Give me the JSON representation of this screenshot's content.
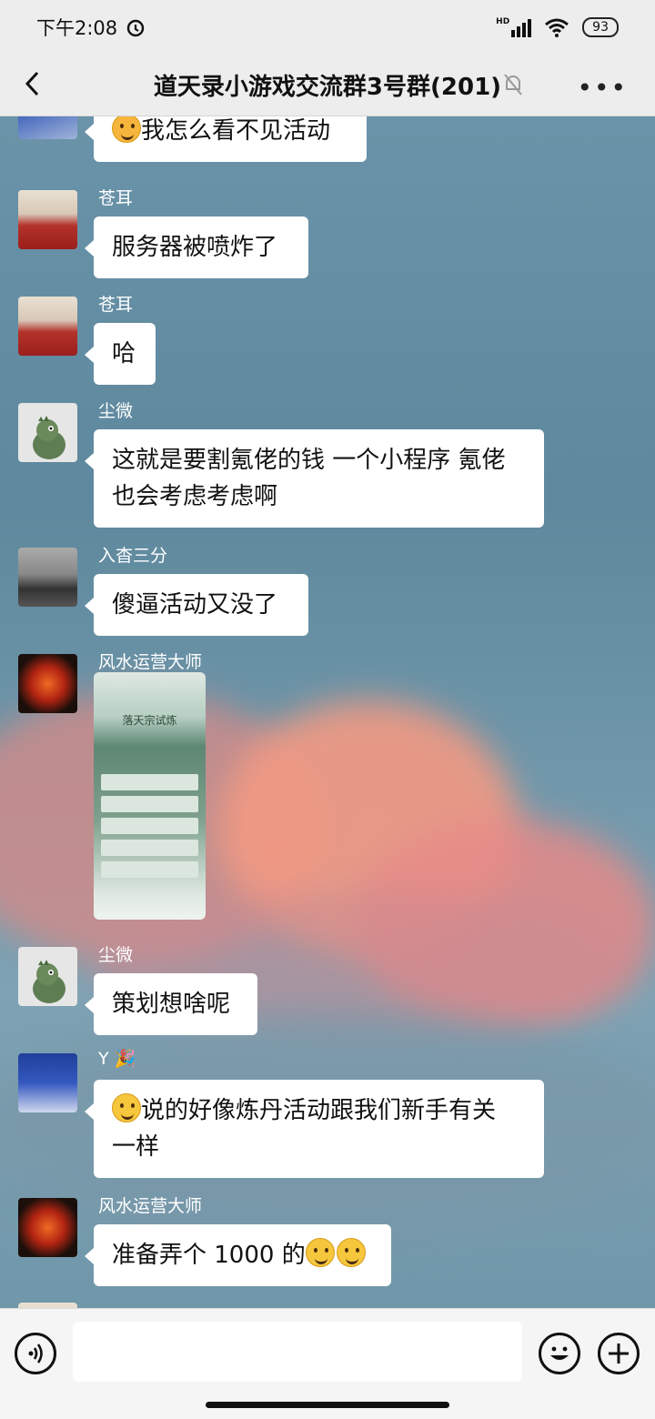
{
  "status_bar": {
    "time": "下午2:08",
    "network": "HD",
    "battery": "93"
  },
  "header": {
    "title": "道天录小游戏交流群3号群(201)"
  },
  "messages": [
    {
      "sender": "",
      "text": "我怎么看不见活动"
    },
    {
      "sender": "苍耳",
      "text": "服务器被喷炸了"
    },
    {
      "sender": "苍耳",
      "text": "哈"
    },
    {
      "sender": "尘微",
      "text_line1": "这就是要割氪佬的钱 一个小程序 氪佬",
      "text_line2": "也会考虑考虑啊"
    },
    {
      "sender": "入杳三分",
      "text": "傻逼活动又没了"
    },
    {
      "sender": "风水运营大师",
      "image_caption": "落天宗试炼"
    },
    {
      "sender": "尘微",
      "text": "策划想啥呢"
    },
    {
      "sender": "Y",
      "text_line1": "说的好像炼丹活动跟我们新手有关",
      "text_line2": "一样"
    },
    {
      "sender": "风水运营大师",
      "text": "准备弄个 1000 的"
    }
  ],
  "input": {
    "placeholder": ""
  },
  "colors": {
    "bubble": "#ffffff",
    "bar": "#ededed",
    "sky": "#5f8aa0",
    "cloud": "#e58b84"
  }
}
